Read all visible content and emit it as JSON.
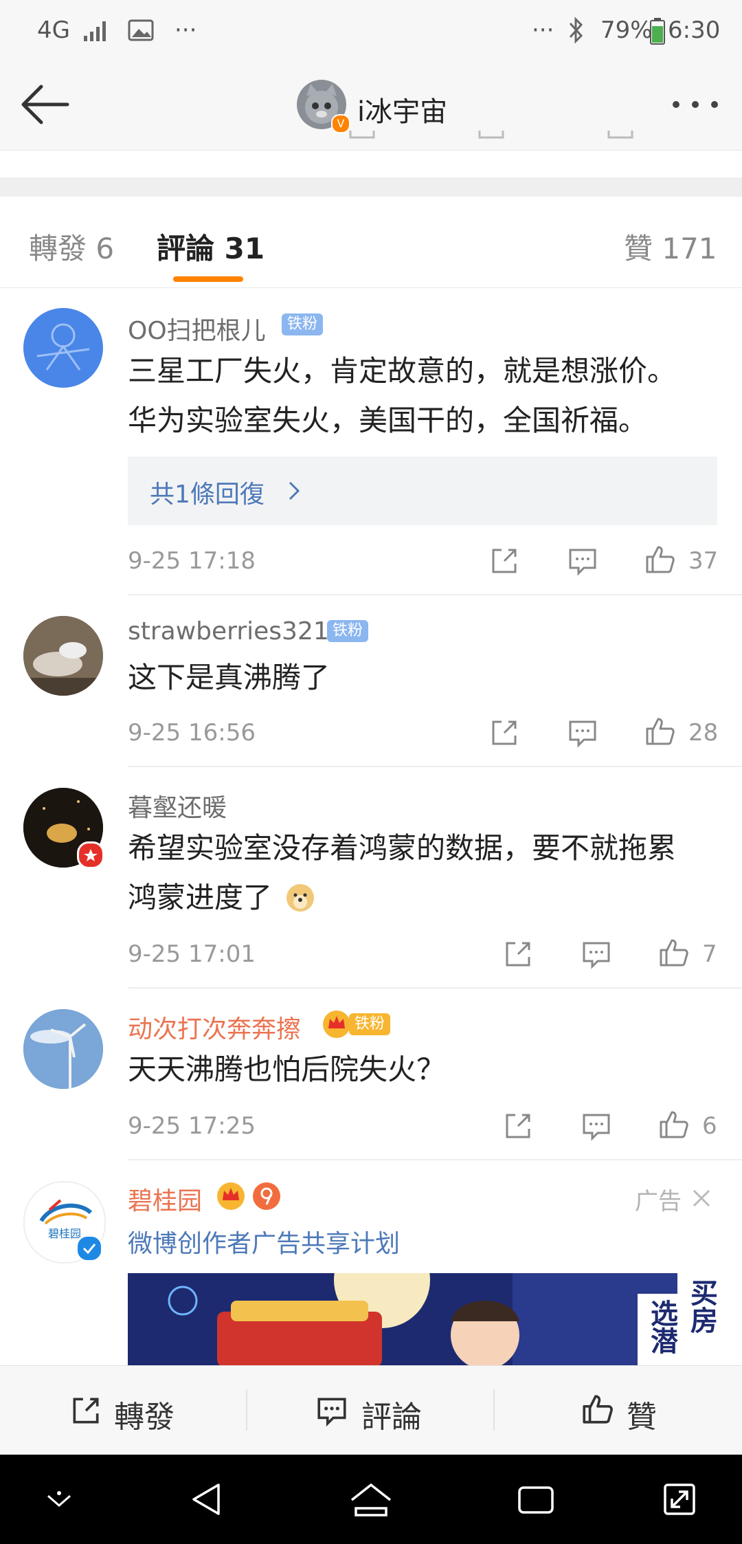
{
  "status_bar": {
    "network": "4G",
    "left_more": "···",
    "right_more": "···",
    "battery": "79%",
    "time": "6:30"
  },
  "header": {
    "title": "i冰宇宙"
  },
  "tabs": [
    {
      "label": "轉發 6"
    },
    {
      "label": "評論 31"
    },
    {
      "label": "贊 171"
    }
  ],
  "comments": [
    {
      "username": "OO扫把根儿",
      "badge": "铁粉",
      "text_lines": [
        "三星工厂失火，肯定故意的，就是想涨价。",
        "华为实验室失火，美国干的，全国祈福。"
      ],
      "reply_label": "共1條回復",
      "time": "9-25 17:18",
      "likes": "37"
    },
    {
      "username": "strawberries321",
      "badge": "铁粉",
      "text_lines": [
        "这下是真沸腾了"
      ],
      "time": "9-25 16:56",
      "likes": "28"
    },
    {
      "username": "暮壑还暖",
      "text_lines": [
        "希望实验室没存着鸿蒙的数据，要不就拖累",
        "鸿蒙进度了"
      ],
      "time": "9-25 17:01",
      "likes": "7"
    },
    {
      "username": "动次打次奔奔擦",
      "badge": "铁粉",
      "text_lines": [
        "天天沸腾也怕后院失火？"
      ],
      "time": "9-25 17:25",
      "likes": "6"
    }
  ],
  "ad": {
    "username": "碧桂园",
    "ad_label": "广告",
    "subtitle": "微博创作者广告共享计划",
    "logo_text": "碧桂园",
    "banner_vertical_1": "买房",
    "banner_vertical_2": "选潜"
  },
  "bottom_bar": {
    "repost": "轉發",
    "comment": "評論",
    "like": "贊"
  },
  "colors": {
    "accent": "#ff8200",
    "link": "#4d79b8",
    "orange_name": "#eb7350",
    "badge_blue": "#8bb6f0"
  }
}
